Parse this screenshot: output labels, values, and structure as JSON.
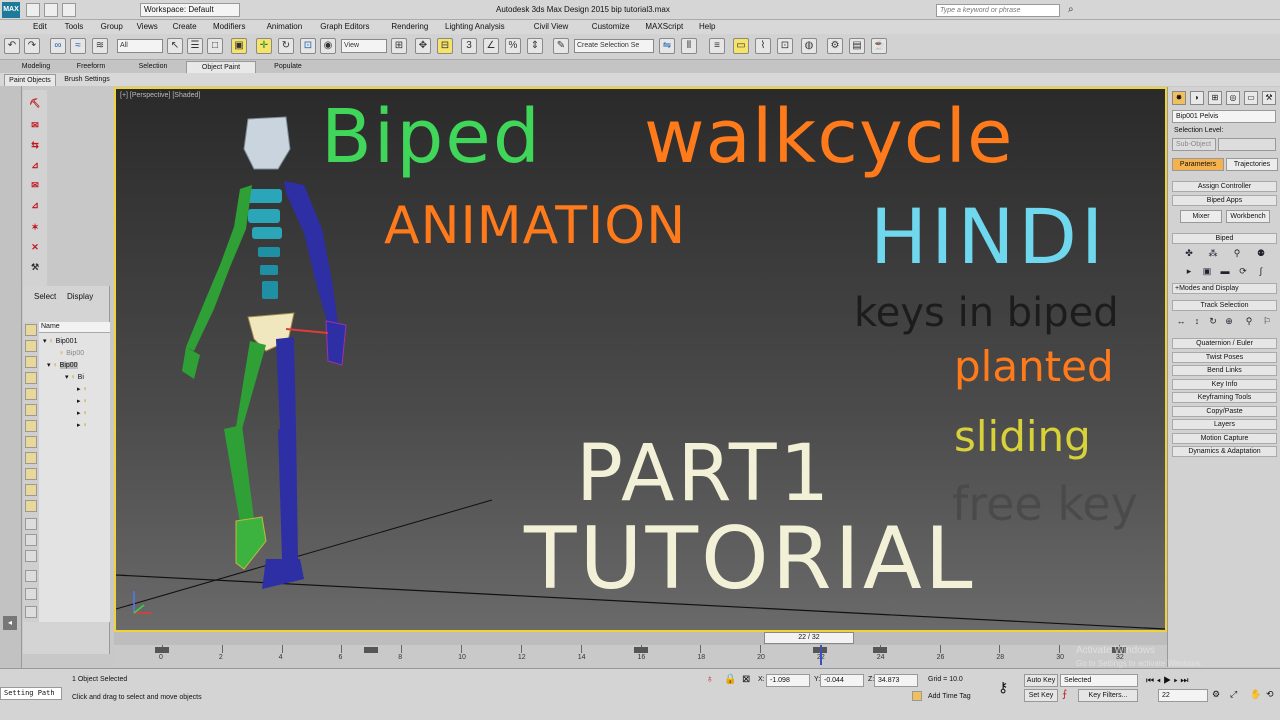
{
  "titlebar": {
    "logo": "MAX",
    "workspace": "Workspace: Default",
    "window_title": "Autodesk 3ds Max Design 2015    bip tutorial3.max",
    "search_placeholder": "Type a keyword or phrase"
  },
  "menu": [
    "Edit",
    "Tools",
    "Group",
    "Views",
    "Create",
    "Modifiers",
    "Animation",
    "Graph Editors",
    "Rendering",
    "Lighting Analysis",
    "Civil View",
    "Customize",
    "MAXScript",
    "Help"
  ],
  "toolbar": {
    "filter_dropdown": "All",
    "refcoord_dropdown": "View",
    "selection_set": "Create Selection Se"
  },
  "ribbon": {
    "tabs": [
      "Modeling",
      "Freeform",
      "Selection",
      "Object Paint",
      "Populate"
    ],
    "sub_tabs": [
      "Paint Objects",
      "Brush Settings"
    ]
  },
  "scene_explorer": {
    "tabs": [
      "Select",
      "Display"
    ],
    "column_header": "Name",
    "items": [
      "Bip001",
      "Bip00",
      "Bip00",
      "Bi"
    ]
  },
  "viewport": {
    "label": "[+] [Perspective] [Shaded]"
  },
  "overlay": {
    "title1": "Biped",
    "title2": "walkcycle",
    "animation": "ANIMATION",
    "hindi": "HINDI",
    "keys": "keys in biped",
    "planted": "planted",
    "sliding": "sliding",
    "free_key": "free key",
    "part": "PART1",
    "tutorial": "TUTORIAL",
    "colors": {
      "green": "#3fd65a",
      "orange": "#ff7a1a",
      "cyan": "#6fd8ee",
      "dark": "#1c1c1c",
      "yellow": "#d8d13a",
      "gray": "#4a4a4a",
      "cream": "#f2f1d8"
    }
  },
  "command_panel": {
    "object_name": "Bip001 Pelvis",
    "selection_level": "Selection Level:",
    "sub_object": "Sub-Object",
    "tabs": [
      "Parameters",
      "Trajectories"
    ],
    "rollouts_top": [
      "Assign Controller",
      "Biped Apps"
    ],
    "biped_apps_buttons": [
      "Mixer",
      "Workbench"
    ],
    "biped_header": "Biped",
    "modes_display": "+Modes and Display",
    "track_selection": "Track Selection",
    "rollouts": [
      "Quaternion / Euler",
      "Twist Poses",
      "Bend Links",
      "Key Info",
      "Keyframing Tools",
      "Copy/Paste",
      "Layers",
      "Motion Capture",
      "Dynamics & Adaptation"
    ]
  },
  "timeline": {
    "frame_display": "22 / 32",
    "current_frame": 22,
    "total_frames": 32,
    "tick_labels": [
      "0",
      "2",
      "4",
      "6",
      "8",
      "10",
      "12",
      "14",
      "16",
      "18",
      "20",
      "22",
      "24",
      "26",
      "28",
      "30",
      "32"
    ],
    "keyframes": [
      0,
      7,
      16,
      22,
      24,
      32
    ]
  },
  "status": {
    "left_label": "Setting Path",
    "selected_text": "1 Object Selected",
    "prompt": "Click and drag to select and move objects",
    "x_label": "X:",
    "x_value": "-1.098",
    "y_label": "Y:",
    "y_value": "-0.044",
    "z_label": "Z:",
    "z_value": "34.873",
    "grid": "Grid = 10.0",
    "add_time_tag": "Add Time Tag",
    "auto_key": "Auto Key",
    "set_key": "Set Key",
    "selected_dropdown": "Selected",
    "key_filters": "Key Filters...",
    "frame_field": "22"
  },
  "watermark": {
    "line1": "Activate Windows",
    "line2": "Go to Settings to activate Windows."
  }
}
